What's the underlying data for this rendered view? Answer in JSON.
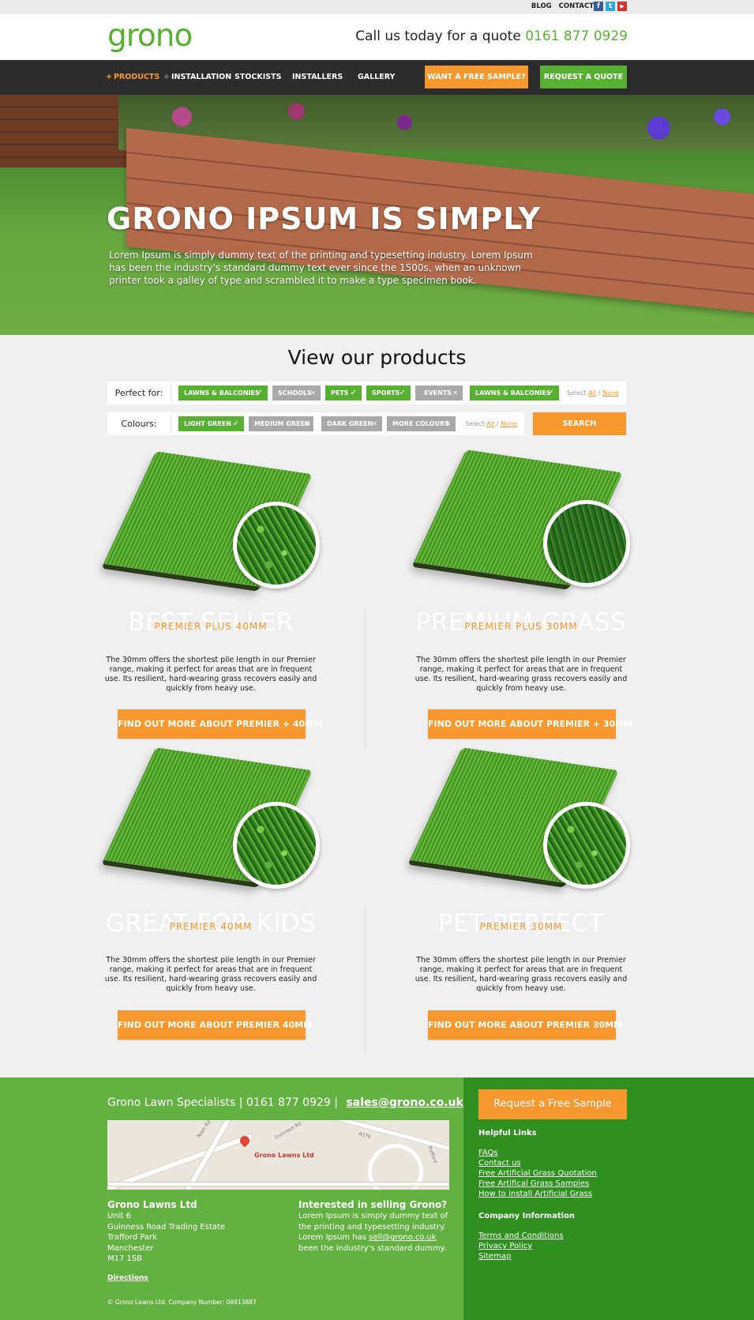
{
  "utility": {
    "links": [
      "BLOG",
      "CONTACT"
    ],
    "social": [
      {
        "icon": "facebook-icon",
        "glyph": "f",
        "color": "#3b5998"
      },
      {
        "icon": "twitter-icon",
        "glyph": "t",
        "color": "#2aa9e0"
      },
      {
        "icon": "youtube-icon",
        "glyph": "▶",
        "color": "#d2322d"
      }
    ]
  },
  "header": {
    "logo": "grono",
    "call_text": "Call us today for a quote",
    "phone": "0161 877 0929"
  },
  "nav": {
    "items": [
      {
        "label": "PRODUCTS",
        "plus": "+",
        "active": true
      },
      {
        "label": "INSTALLATION",
        "plus": "+",
        "active": false
      },
      {
        "label": "STOCKISTS",
        "plus": "",
        "active": false
      },
      {
        "label": "INSTALLERS",
        "plus": "",
        "active": false
      },
      {
        "label": "GALLERY",
        "plus": "",
        "active": false
      }
    ],
    "sample_button": "WANT A FREE SAMPLE?",
    "quote_button": "REQUEST A QUOTE"
  },
  "hero": {
    "title": "GRONO IPSUM IS SIMPLY",
    "text": "Lorem Ipsum is simply dummy text of the printing and typesetting industry. Lorem Ipsum has been the industry's standard dummy text ever since the 1500s, when an unknown printer took a galley of type and scrambled it to make a type specimen book."
  },
  "products": {
    "title": "View our products",
    "filters": {
      "perfect_for": {
        "label": "Perfect for:",
        "tags": [
          {
            "label": "LAWNS & BALCONIES",
            "selected": true
          },
          {
            "label": "SCHOOLS",
            "selected": false
          },
          {
            "label": "PETS",
            "selected": true
          },
          {
            "label": "SPORTS",
            "selected": true
          },
          {
            "label": "EVENTS",
            "selected": false
          },
          {
            "label": "LAWNS & BALCONIES",
            "selected": true
          }
        ],
        "select_text": "Select",
        "all": "All",
        "slash": "/",
        "none": "None"
      },
      "colours": {
        "label": "Colours:",
        "tags": [
          {
            "label": "LIGHT GREEN",
            "selected": true
          },
          {
            "label": "MEDIUM GREEN",
            "selected": false
          },
          {
            "label": "DARK GREEN",
            "selected": false
          },
          {
            "label": "MORE COLOURS",
            "selected": false
          }
        ],
        "select_text": "Select",
        "all": "All",
        "slash": "/",
        "none": "None"
      },
      "search_button": "SEARCH"
    },
    "check_glyph": "✓",
    "cross_glyph": "✕",
    "items": [
      {
        "badge": "BEST SELLER",
        "name": "PREMIER PLUS 40MM",
        "description": "The 30mm offers the shortest pile length in our Premier range, making it perfect for areas that are in frequent use. Its resilient, hard-wearing grass recovers easily and quickly from heavy use.",
        "button": "FIND OUT MORE ABOUT PREMIER + 40MM"
      },
      {
        "badge": "PREMIUM GRASS",
        "name": "PREMIER PLUS 30MM",
        "description": "The 30mm offers the shortest pile length in our Premier range, making it perfect for areas that are in frequent use. Its resilient, hard-wearing grass recovers easily and quickly from heavy use.",
        "button": "FIND OUT MORE ABOUT PREMIER + 30MM"
      },
      {
        "badge": "GREAT FOR KIDS",
        "name": "PREMIER 40MM",
        "description": "The 30mm offers the shortest pile length in our Premier range, making it perfect for areas that are in frequent use. Its resilient, hard-wearing grass recovers easily and quickly from heavy use.",
        "button": "FIND OUT MORE ABOUT PREMIER 40MM"
      },
      {
        "badge": "PET PERFECT",
        "name": "PREMIER 30MM",
        "description": "The 30mm offers the shortest pile length in our Premier range, making it perfect for areas that are in frequent use. Its resilient, hard-wearing grass recovers easily and quickly from heavy use.",
        "button": "FIND OUT MORE ABOUT PREMIER 30MM"
      }
    ]
  },
  "footer": {
    "contact_line": "Grono Lawn Specialists | 0161 877 0929 |",
    "email": "sales@grono.co.uk",
    "map": {
      "label": "Grono Lawns Ltd",
      "streets": [
        "Nash Rd",
        "Guinness Rd",
        "A576",
        "Trafford"
      ]
    },
    "company": {
      "name": "Grono Lawns Ltd",
      "address": [
        "Unit 6",
        "Guinness Road Trading Estate",
        "Trafford Park",
        "Manchester",
        "M17 1SB"
      ],
      "directions": "Directions"
    },
    "selling": {
      "heading": "Interested in selling Grono?",
      "line1": "Lorem Ipsum is simply dummy text of",
      "line2": "the printing and typesetting industry.",
      "line3_pre": "Lorem Ipsum has",
      "line3_email": "sell@grono.co.uk",
      "line4": "been the industry's standard dummy."
    },
    "copyright": "© Grono Lawns Ltd. Company Number: 06913887",
    "sample_button": "Request a Free Sample",
    "helpful_heading": "Helpful Links",
    "helpful_links": [
      "FAQs",
      "Contact us",
      "Free Artificial Grass Quotation",
      "Free Artifical Grass Samples",
      "How to install Artificial Grass"
    ],
    "company_heading": "Company Information",
    "company_links": [
      "Terms and Conditions",
      "Privacy Policy",
      "Sitemap"
    ]
  },
  "colors": {
    "brand_green": "#58b033",
    "accent_orange": "#f7982e",
    "nav_dark": "#2c2c2c",
    "footer_green": "#63b141",
    "footer_dark_green": "#2f8f1f"
  }
}
